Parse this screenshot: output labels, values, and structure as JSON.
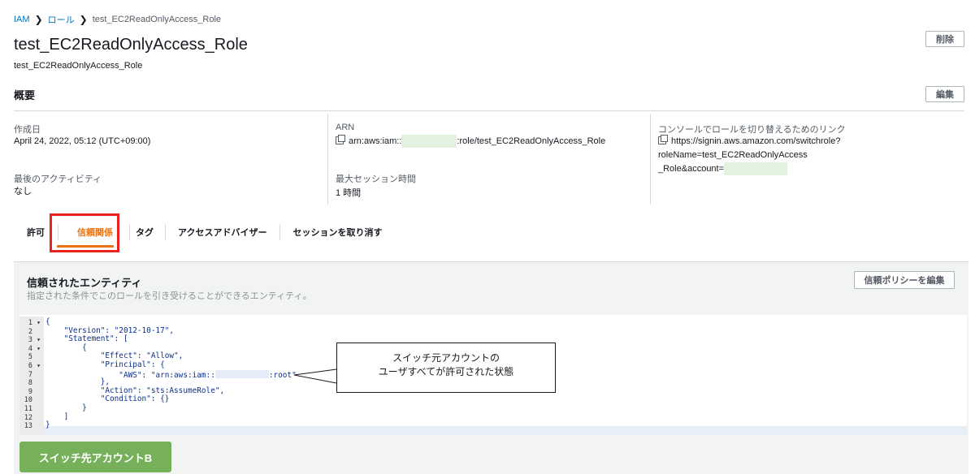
{
  "breadcrumb": {
    "root": "IAM",
    "level2": "ロール",
    "current": "test_EC2ReadOnlyAccess_Role"
  },
  "header": {
    "title": "test_EC2ReadOnlyAccess_Role",
    "subtitle": "test_EC2ReadOnlyAccess_Role",
    "delete_label": "削除"
  },
  "summary": {
    "heading": "概要",
    "edit_label": "編集",
    "created_label": "作成日",
    "created_value": "April 24, 2022, 05:12 (UTC+09:00)",
    "last_activity_label": "最後のアクティビティ",
    "last_activity_value": "なし",
    "arn_label": "ARN",
    "arn_prefix": "arn:aws:iam::",
    "arn_suffix": ":role/test_EC2ReadOnlyAccess_Role",
    "max_session_label": "最大セッション時間",
    "max_session_value": "1 時間",
    "switch_link_label": "コンソールでロールを切り替えるためのリンク",
    "switch_link_line1": "https://signin.aws.amazon.com/switchrole?roleName=test_EC2ReadOnlyAccess",
    "switch_link_line2": "_Role&account="
  },
  "tabs": [
    {
      "label": "許可"
    },
    {
      "label": "信頼関係"
    },
    {
      "label": "タグ"
    },
    {
      "label": "アクセスアドバイザー"
    },
    {
      "label": "セッションを取り消す"
    }
  ],
  "trusted": {
    "title": "信頼されたエンティティ",
    "description": "指定された条件でこのロールを引き受けることができるエンティティ。",
    "edit_policy_label": "信頼ポリシーを編集"
  },
  "code_lines": [
    {
      "num": "1",
      "fold": "▾",
      "text": "{"
    },
    {
      "num": "2",
      "fold": "",
      "text": "    \"Version\": \"2012-10-17\","
    },
    {
      "num": "3",
      "fold": "▾",
      "text": "    \"Statement\": ["
    },
    {
      "num": "4",
      "fold": "▾",
      "text": "        {"
    },
    {
      "num": "5",
      "fold": "",
      "text": "            \"Effect\": \"Allow\","
    },
    {
      "num": "6",
      "fold": "▾",
      "text": "            \"Principal\": {"
    },
    {
      "num": "7",
      "fold": "",
      "text": "                \"AWS\": \"arn:aws:iam::",
      "after": ":root\""
    },
    {
      "num": "8",
      "fold": "",
      "text": "            },"
    },
    {
      "num": "9",
      "fold": "",
      "text": "            \"Action\": \"sts:AssumeRole\","
    },
    {
      "num": "10",
      "fold": "",
      "text": "            \"Condition\": {}"
    },
    {
      "num": "11",
      "fold": "",
      "text": "        }"
    },
    {
      "num": "12",
      "fold": "",
      "text": "    ]"
    },
    {
      "num": "13",
      "fold": "",
      "text": "}"
    }
  ],
  "callout": {
    "line1": "スイッチ元アカウントの",
    "line2": "ユーザすべてが許可された状態"
  },
  "account_label": "スイッチ先アカウントB",
  "colors": {
    "accent": "#ec7211",
    "link": "#0073bb",
    "highlight": "#e8231d",
    "account_badge": "#77b05a"
  }
}
